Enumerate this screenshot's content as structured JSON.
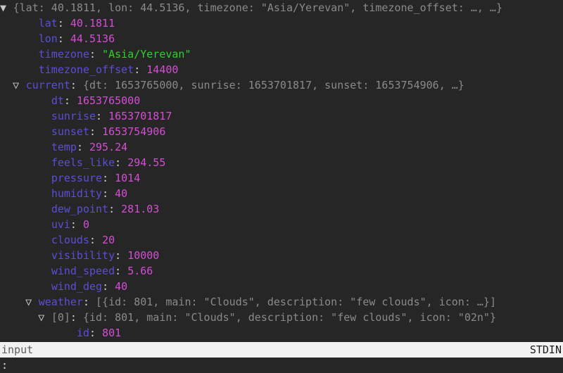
{
  "app": {
    "background": "#262626",
    "key_color": "#5a4fd6",
    "number_color": "#d44ed4",
    "string_color": "#2fcf2f",
    "preview_color": "#8a8a8a",
    "punct_color": "#d0d0d0"
  },
  "glyphs": {
    "triangle_open_filled": "▼",
    "triangle_open_hollow": "▽",
    "ellipsis": "…"
  },
  "rows": [
    {
      "indent": 0,
      "tri": "filled",
      "key": "",
      "sep": "",
      "preview": "{lat: 40.1811, lon: 44.5136, timezone: \"Asia/Yerevan\", timezone_offset: …, …}"
    },
    {
      "indent": 2,
      "tri": "none",
      "key": "lat",
      "sep": ": ",
      "value": "40.1811",
      "value_type": "number"
    },
    {
      "indent": 2,
      "tri": "none",
      "key": "lon",
      "sep": ": ",
      "value": "44.5136",
      "value_type": "number"
    },
    {
      "indent": 2,
      "tri": "none",
      "key": "timezone",
      "sep": ": ",
      "value": "\"Asia/Yerevan\"",
      "value_type": "string"
    },
    {
      "indent": 2,
      "tri": "none",
      "key": "timezone_offset",
      "sep": ": ",
      "value": "14400",
      "value_type": "number"
    },
    {
      "indent": 1,
      "tri": "hollow",
      "key": "current",
      "sep": ": ",
      "preview": "{dt: 1653765000, sunrise: 1653701817, sunset: 1653754906, …}"
    },
    {
      "indent": 3,
      "tri": "none",
      "key": "dt",
      "sep": ": ",
      "value": "1653765000",
      "value_type": "number"
    },
    {
      "indent": 3,
      "tri": "none",
      "key": "sunrise",
      "sep": ": ",
      "value": "1653701817",
      "value_type": "number"
    },
    {
      "indent": 3,
      "tri": "none",
      "key": "sunset",
      "sep": ": ",
      "value": "1653754906",
      "value_type": "number"
    },
    {
      "indent": 3,
      "tri": "none",
      "key": "temp",
      "sep": ": ",
      "value": "295.24",
      "value_type": "number"
    },
    {
      "indent": 3,
      "tri": "none",
      "key": "feels_like",
      "sep": ": ",
      "value": "294.55",
      "value_type": "number"
    },
    {
      "indent": 3,
      "tri": "none",
      "key": "pressure",
      "sep": ": ",
      "value": "1014",
      "value_type": "number"
    },
    {
      "indent": 3,
      "tri": "none",
      "key": "humidity",
      "sep": ": ",
      "value": "40",
      "value_type": "number"
    },
    {
      "indent": 3,
      "tri": "none",
      "key": "dew_point",
      "sep": ": ",
      "value": "281.03",
      "value_type": "number"
    },
    {
      "indent": 3,
      "tri": "none",
      "key": "uvi",
      "sep": ": ",
      "value": "0",
      "value_type": "number"
    },
    {
      "indent": 3,
      "tri": "none",
      "key": "clouds",
      "sep": ": ",
      "value": "20",
      "value_type": "number"
    },
    {
      "indent": 3,
      "tri": "none",
      "key": "visibility",
      "sep": ": ",
      "value": "10000",
      "value_type": "number"
    },
    {
      "indent": 3,
      "tri": "none",
      "key": "wind_speed",
      "sep": ": ",
      "value": "5.66",
      "value_type": "number"
    },
    {
      "indent": 3,
      "tri": "none",
      "key": "wind_deg",
      "sep": ": ",
      "value": "40",
      "value_type": "number"
    },
    {
      "indent": 2,
      "tri": "hollow",
      "key": "weather",
      "sep": ": ",
      "preview": "[{id: 801, main: \"Clouds\", description: \"few clouds\", icon: …}]"
    },
    {
      "indent": 3,
      "tri": "hollow",
      "key": "[0]",
      "key_dim": true,
      "sep": ": ",
      "preview": "{id: 801, main: \"Clouds\", description: \"few clouds\", icon: \"02n\"}"
    },
    {
      "indent": 5,
      "tri": "none",
      "key": "id",
      "sep": ": ",
      "value": "801",
      "value_type": "number"
    }
  ],
  "statusbar": {
    "left_label": "input",
    "right_label": "STDIN"
  },
  "prompt": {
    "text": ":"
  }
}
